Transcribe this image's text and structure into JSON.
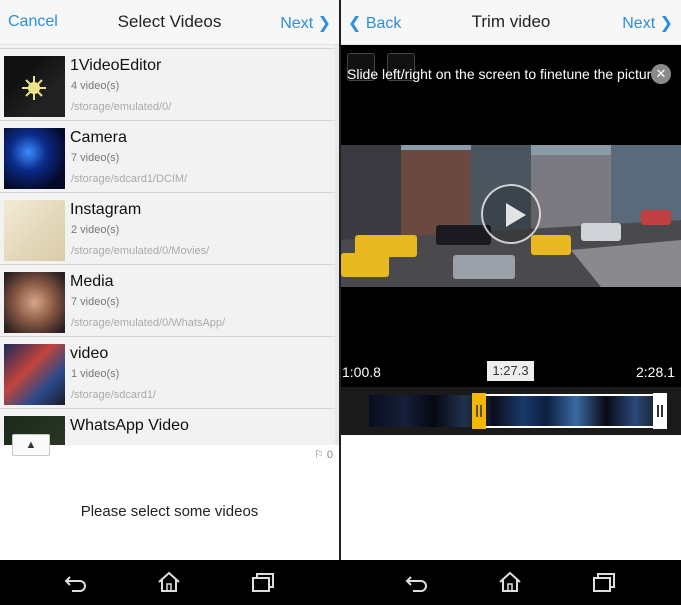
{
  "left": {
    "header": {
      "cancel": "Cancel",
      "title": "Select Videos",
      "next": "Next ❯"
    },
    "folders": [
      {
        "name": "1VideoEditor",
        "count": "4 video(s)",
        "path": "/storage/emulated/0/"
      },
      {
        "name": "Camera",
        "count": "7 video(s)",
        "path": "/storage/sdcard1/DCIM/"
      },
      {
        "name": "Instagram",
        "count": "2 video(s)",
        "path": "/storage/emulated/0/Movies/"
      },
      {
        "name": "Media",
        "count": "7 video(s)",
        "path": "/storage/emulated/0/WhatsApp/"
      },
      {
        "name": "video",
        "count": "1 video(s)",
        "path": "/storage/sdcard1/"
      },
      {
        "name": "WhatsApp Video",
        "count": "",
        "path": ""
      }
    ],
    "collapse_icon": "▲",
    "selected_count": "0",
    "flag_icon": "⚐",
    "hint": "Please select some videos"
  },
  "right": {
    "header": {
      "back": "❮ Back",
      "title": "Trim video",
      "next": "Next ❯"
    },
    "tip": "Slide left/right on the screen to finetune the picture",
    "close_icon": "✕",
    "times": {
      "start": "1:00.8",
      "current": "1:27.3",
      "end": "2:28.1"
    },
    "handle_color": "#f5b800"
  },
  "navbar": {
    "icons": [
      "back-icon",
      "home-icon",
      "recent-apps-icon"
    ]
  },
  "colors": {
    "accent": "#2b8fe0"
  }
}
